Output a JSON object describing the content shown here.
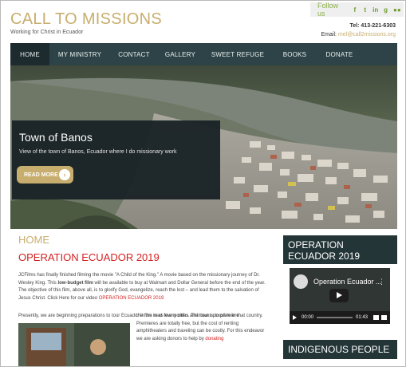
{
  "header": {
    "title": "CALL TO MISSIONS",
    "tagline": "Working for Christ in Ecuador",
    "follow_label": "Follow us",
    "social": [
      "f",
      "t",
      "in",
      "g",
      "●●"
    ],
    "tel_label": "Tel: 413-221-6303",
    "email_label": "Email:",
    "email_value": "mel@call2missions.org"
  },
  "nav": {
    "items": [
      "HOME",
      "MY MINISTRY",
      "CONTACT",
      "GALLERY",
      "SWEET REFUGE",
      "BOOKS",
      "DONATE"
    ],
    "active": "HOME"
  },
  "slider": {
    "title": "Town of Banos",
    "text": "View of the town of Banos, Ecuador where I do missionary work",
    "button": "READ MORE",
    "button_arrow": "›"
  },
  "main": {
    "heading": "HOME",
    "article_title": "OPERATION ECUADOR 2019",
    "p1_a": "JCFilms has finally finished filming the movie \"A Child of the King.\" A movie based on the missionary journey of Dr. Wesley King. This ",
    "p1_strong": "low-budget film",
    "p1_b": " will be available to buy at Walmart and Dollar General before the end of the year. The objective of this film, above all, is to glorify God, evangelize, reach the lost – and lead them to the salvation of Jesus Christ. Click Here for our video ",
    "p1_link": "OPERATION ECUADOR 2019",
    "p2_left": "Presently, we are beginning preparations to tour Ecuador in the next few months. The tour is to premiere",
    "p2_right_a": "the film in as many cities and towns possible in that country.  Premieres are totally free, but the cost of renting amphitheaters and traveling can be costly. For this endeavor we are asking donors to help by ",
    "p2_right_link": "donating"
  },
  "sidebar": {
    "widget1_title": "OPERATION ECUADOR 2019",
    "video_title": "Operation Ecuador ...",
    "video_menu": "⋮",
    "time_current": "00:00",
    "time_total": "01:43",
    "widget2_title": "INDIGENOUS PEOPLE"
  },
  "colors": {
    "accent": "#c8ae6e",
    "nav": "#2e4347",
    "link_red": "#d62020",
    "social_green": "#6e9b2c"
  }
}
